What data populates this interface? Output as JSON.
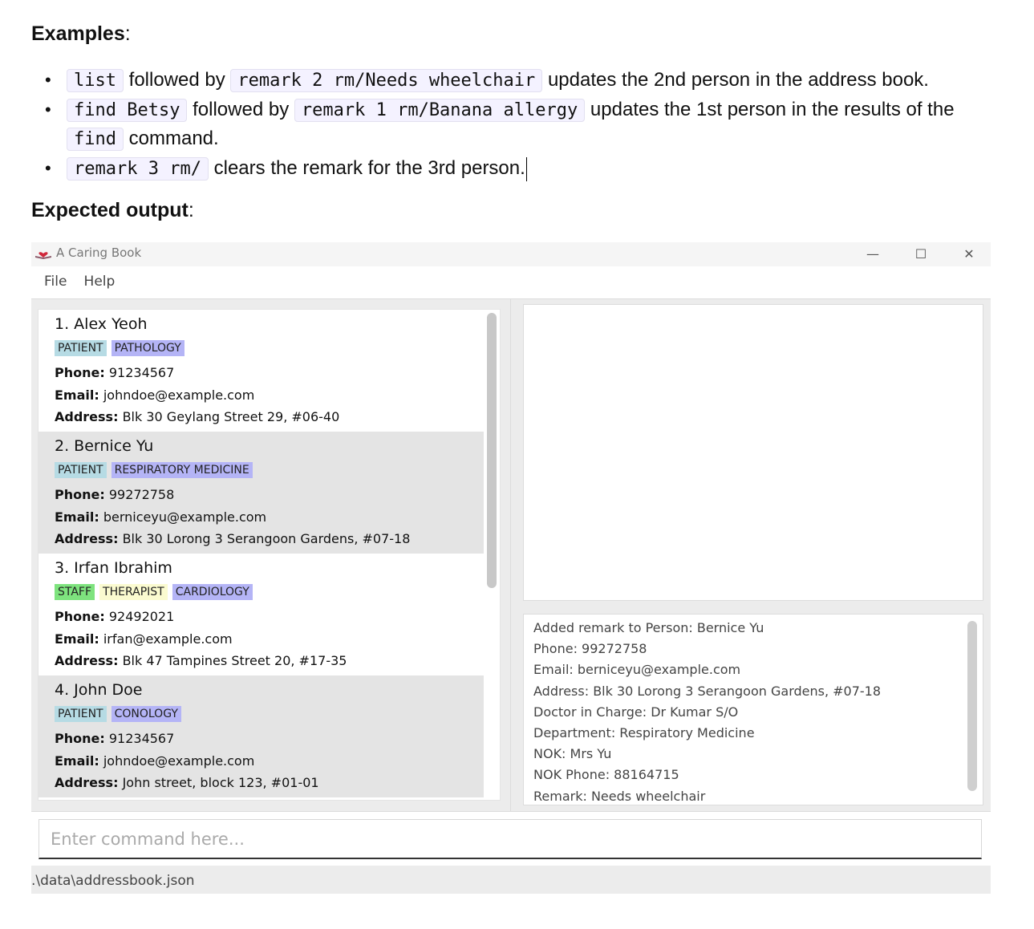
{
  "doc": {
    "examples_heading": "Examples",
    "examples": [
      {
        "code1": "list",
        "text1": "followed by",
        "code2": "remark 2 rm/Needs wheelchair",
        "text2": "updates the 2nd person in the address book."
      },
      {
        "code1": "find Betsy",
        "text1": "followed by",
        "code2": "remark 1 rm/Banana allergy",
        "text2": "updates the 1st person in the results of the",
        "code3": "find",
        "text3": "command."
      },
      {
        "code1": "remark 3 rm/",
        "text1": "clears the remark for the 3rd person."
      }
    ],
    "expected_heading": "Expected output"
  },
  "window": {
    "title": "A Caring Book",
    "icon": "book-heart-icon",
    "min_label": "—",
    "max_label": "☐",
    "close_label": "✕"
  },
  "menu": {
    "file": "File",
    "help": "Help"
  },
  "persons": [
    {
      "name": "1. Alex Yeoh",
      "tags": [
        "PATIENT",
        "PATHOLOGY"
      ],
      "phone_label": "Phone:",
      "phone": "91234567",
      "email_label": "Email:",
      "email": "johndoe@example.com",
      "address_label": "Address:",
      "address": "Blk 30 Geylang Street 29, #06-40"
    },
    {
      "name": "2. Bernice Yu",
      "tags": [
        "PATIENT",
        "RESPIRATORY MEDICINE"
      ],
      "phone_label": "Phone:",
      "phone": "99272758",
      "email_label": "Email:",
      "email": "berniceyu@example.com",
      "address_label": "Address:",
      "address": "Blk 30 Lorong 3 Serangoon Gardens, #07-18"
    },
    {
      "name": "3. Irfan Ibrahim",
      "tags": [
        "STAFF",
        "THERAPIST",
        "CARDIOLOGY"
      ],
      "phone_label": "Phone:",
      "phone": "92492021",
      "email_label": "Email:",
      "email": "irfan@example.com",
      "address_label": "Address:",
      "address": "Blk 47 Tampines Street 20, #17-35"
    },
    {
      "name": "4. John Doe",
      "tags": [
        "PATIENT",
        "CONOLOGY"
      ],
      "phone_label": "Phone:",
      "phone": "91234567",
      "email_label": "Email:",
      "email": "johndoe@example.com",
      "address_label": "Address:",
      "address": "John street, block 123, #01-01"
    }
  ],
  "result": {
    "lines": [
      "Added remark to Person: Bernice Yu",
      "Phone: 99272758",
      "Email: berniceyu@example.com",
      "Address: Blk 30 Lorong 3 Serangoon Gardens, #07-18",
      "Doctor in Charge: Dr Kumar S/O",
      "Department: Respiratory Medicine",
      "NOK: Mrs Yu",
      "NOK Phone: 88164715",
      "Remark: Needs wheelchair"
    ]
  },
  "command": {
    "placeholder": "Enter command here...",
    "value": ""
  },
  "status": {
    "path": ".\\data\\addressbook.json"
  }
}
